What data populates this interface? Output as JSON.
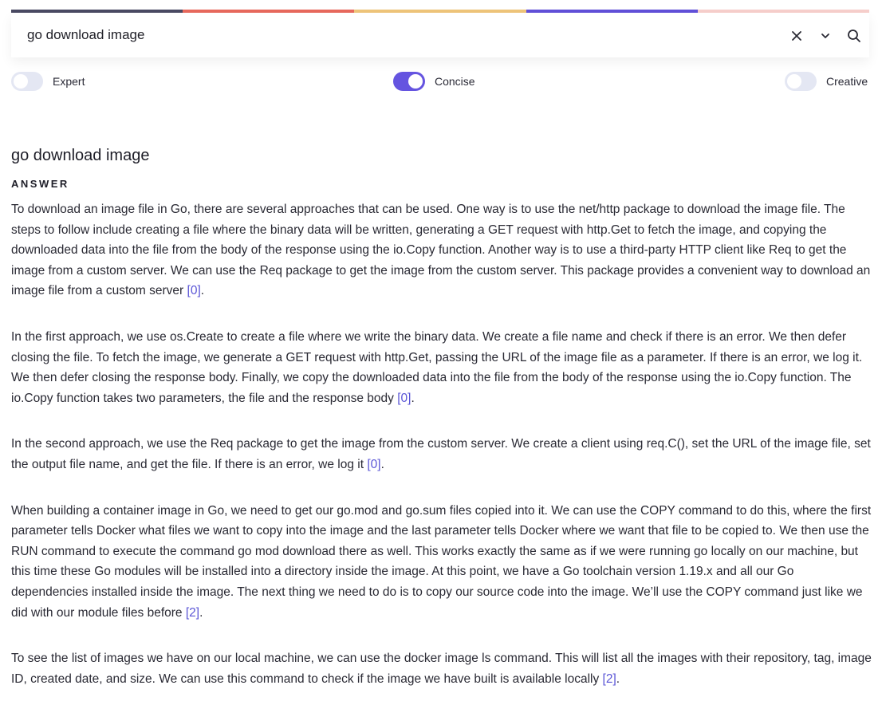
{
  "colorbar": [
    "#4a4a63",
    "#e8695d",
    "#efc57a",
    "#6150d9",
    "#f7cfcc"
  ],
  "search": {
    "value": "go download image",
    "clear_icon": "close-icon",
    "expand_icon": "chevron-down-icon",
    "search_icon": "search-icon"
  },
  "modes": [
    {
      "label": "Expert",
      "on": false
    },
    {
      "label": "Concise",
      "on": true
    },
    {
      "label": "Creative",
      "on": false
    }
  ],
  "query_title": "go download image",
  "answer_label": "ANSWER",
  "accent": "#6554e0",
  "paragraphs": [
    {
      "text": "To download an image file in Go, there are several approaches that can be used. One way is to use the net/http package to download the image file. The steps to follow include creating a file where the binary data will be written, generating a GET request with http.Get to fetch the image, and copying the downloaded data into the file from the body of the response using the io.Copy function. Another way is to use a third-party HTTP client like Req to get the image from a custom server. We can use the Req package to get the image from the custom server. This package provides a convenient way to download an image file from a custom server ",
      "cite": "[0]"
    },
    {
      "text": "In the first approach, we use os.Create to create a file where we write the binary data. We create a file name and check if there is an error. We then defer closing the file. To fetch the image, we generate a GET request with http.Get, passing the URL of the image file as a parameter. If there is an error, we log it. We then defer closing the response body. Finally, we copy the downloaded data into the file from the body of the response using the io.Copy function. The io.Copy function takes two parameters, the file and the response body ",
      "cite": "[0]"
    },
    {
      "text": "In the second approach, we use the Req package to get the image from the custom server. We create a client using req.C(), set the URL of the image file, set the output file name, and get the file. If there is an error, we log it ",
      "cite": "[0]"
    },
    {
      "text": "When building a container image in Go, we need to get our go.mod and go.sum files copied into it. We can use the COPY command to do this, where the first parameter tells Docker what files we want to copy into the image and the last parameter tells Docker where we want that file to be copied to. We then use the RUN command to execute the command go mod download there as well. This works exactly the same as if we were running go locally on our machine, but this time these Go modules will be installed into a directory inside the image. At this point, we have a Go toolchain version 1.19.x and all our Go dependencies installed inside the image. The next thing we need to do is to copy our source code into the image. We’ll use the COPY command just like we did with our module files before ",
      "cite": "[2]"
    },
    {
      "text": "To see the list of images we have on our local machine, we can use the docker image ls command. This will list all the images with their repository, tag, image ID, created date, and size. We can use this command to check if the image we have built is available locally ",
      "cite": "[2]"
    }
  ]
}
